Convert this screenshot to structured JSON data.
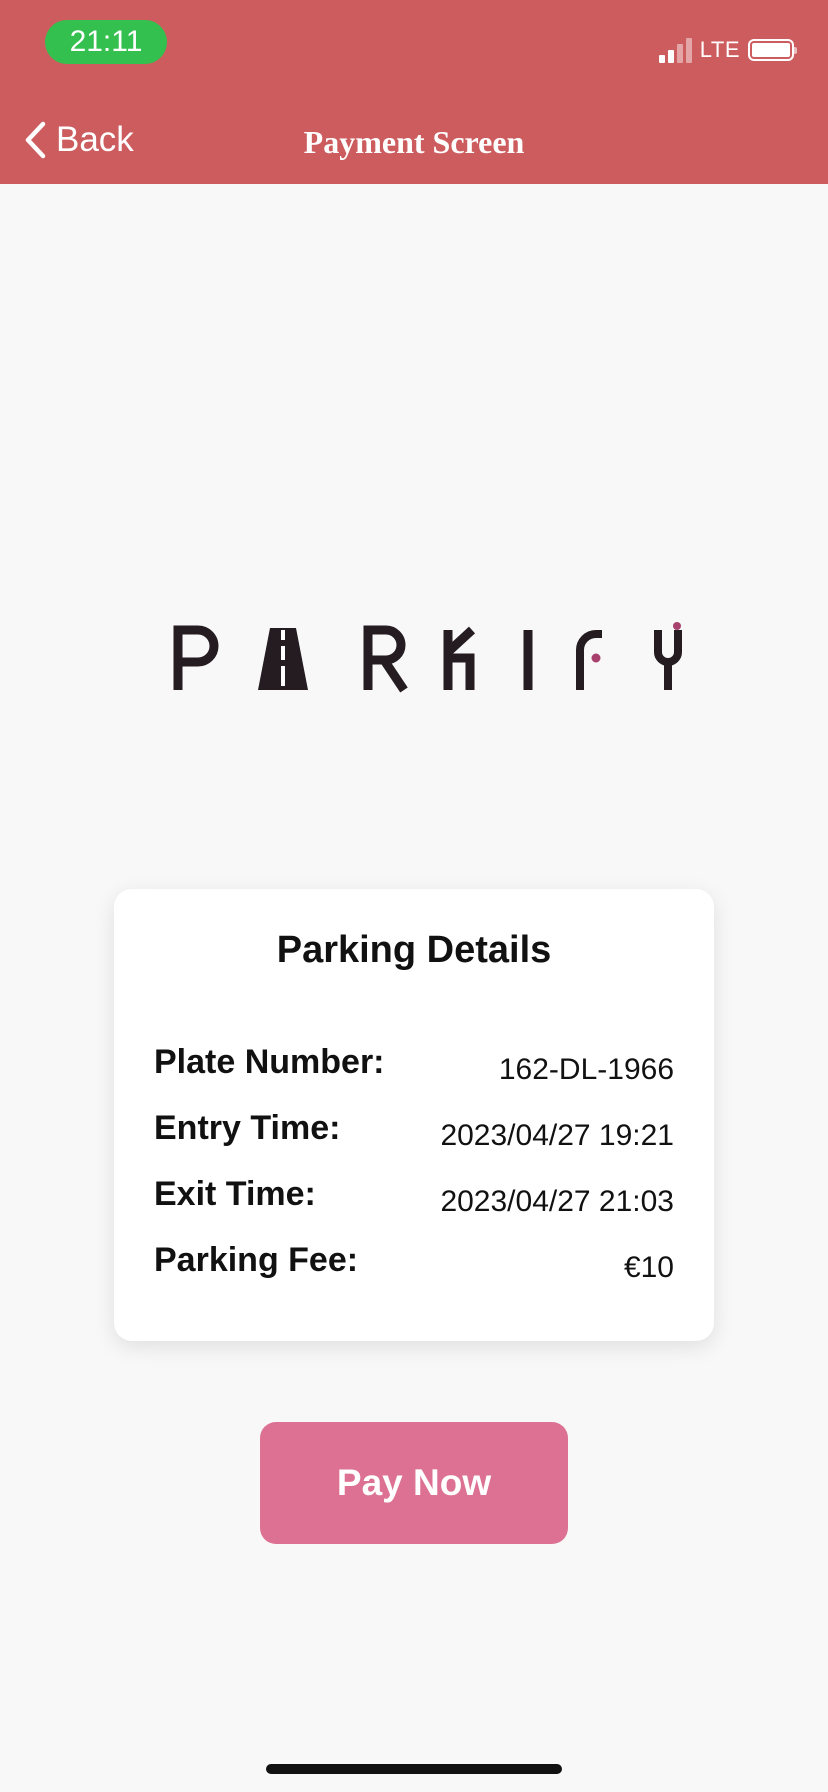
{
  "status_bar": {
    "time": "21:11",
    "network": "LTE",
    "colors": {
      "time_pill": "#34c04f"
    }
  },
  "nav": {
    "back_label": "Back",
    "title": "Payment Screen",
    "back_icon": "chevron-left-icon",
    "background": "#cc5c5e"
  },
  "logo": {
    "text": "PARKIFY",
    "accent_color": "#a8416d"
  },
  "card": {
    "title": "Parking Details",
    "rows": [
      {
        "label": "Plate Number:",
        "value": "162-DL-1966"
      },
      {
        "label": "Entry Time:",
        "value": "2023/04/27 19:21"
      },
      {
        "label": "Exit Time:",
        "value": "2023/04/27 21:03"
      },
      {
        "label": "Parking Fee:",
        "value": "€10"
      }
    ]
  },
  "pay_button": {
    "label": "Pay Now",
    "color": "#dd7194"
  }
}
